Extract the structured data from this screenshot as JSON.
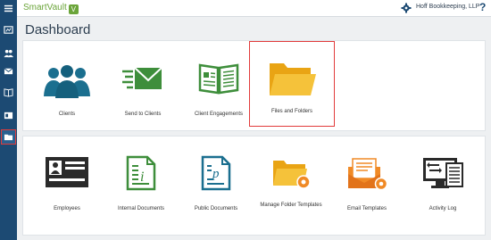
{
  "app": {
    "brand": "SmartVault",
    "brand_badge": "V"
  },
  "header": {
    "account": "Hoff Bookkeeping, LLP",
    "help": "?"
  },
  "page": {
    "title": "Dashboard"
  },
  "row1": [
    {
      "label": "Clients"
    },
    {
      "label": "Send to Clients"
    },
    {
      "label": "Client Engagements"
    },
    {
      "label": "Files and Folders"
    }
  ],
  "row2": [
    {
      "label": "Employees"
    },
    {
      "label": "Internal Documents"
    },
    {
      "label": "Public Documents"
    },
    {
      "label": "Manage Folder Templates"
    },
    {
      "label": "Email Templates"
    },
    {
      "label": "Activity Log"
    }
  ],
  "colors": {
    "rail": "#1c4a73",
    "brand": "#6ba53a",
    "highlight": "#e23b3b",
    "teal": "#1b6f8f",
    "green": "#3e8e3b",
    "orange": "#f08a26",
    "yellow": "#f3b51d"
  }
}
